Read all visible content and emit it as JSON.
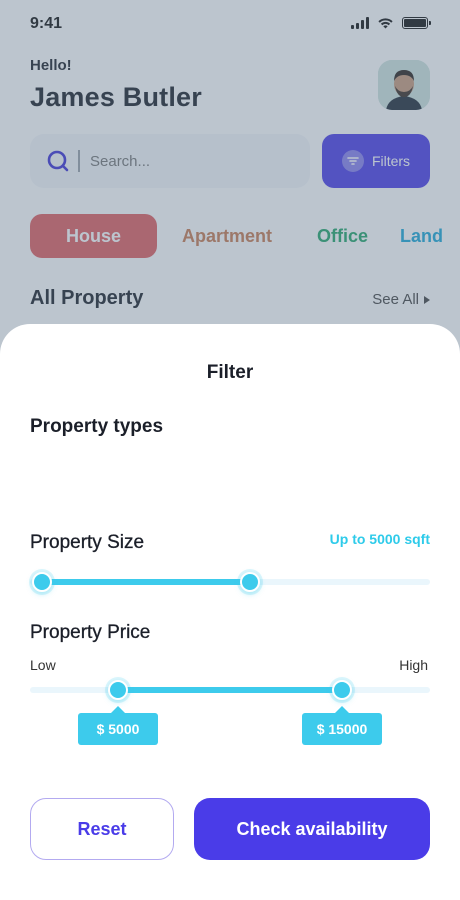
{
  "status_bar": {
    "time": "9:41"
  },
  "header": {
    "greeting": "Hello!",
    "user_name": "James Butler"
  },
  "search": {
    "placeholder": "Search...",
    "filters_label": "Filters"
  },
  "categories": [
    {
      "label": "House",
      "color": "#e05d5f",
      "selected": true
    },
    {
      "label": "Apartment",
      "color": "#c97a52"
    },
    {
      "label": "Office",
      "color": "#22a56a"
    },
    {
      "label": "Land",
      "color": "#1aa8d8"
    }
  ],
  "section": {
    "title": "All Property",
    "see_all": "See All"
  },
  "filter_sheet": {
    "title": "Filter",
    "property_types_title": "Property types",
    "size": {
      "title": "Property Size",
      "value_label": "Up to 5000 sqft",
      "range_fraction": [
        0.03,
        0.55
      ]
    },
    "price": {
      "title": "Property Price",
      "low_label": "Low",
      "high_label": "High",
      "min_tag": "$ 5000",
      "max_tag": "$ 15000",
      "range_fraction": [
        0.22,
        0.78
      ]
    },
    "reset_label": "Reset",
    "check_label": "Check availability"
  },
  "colors": {
    "accent": "#4a3ce8",
    "slider": "#3dcbec",
    "track": "#eaf6fc"
  }
}
